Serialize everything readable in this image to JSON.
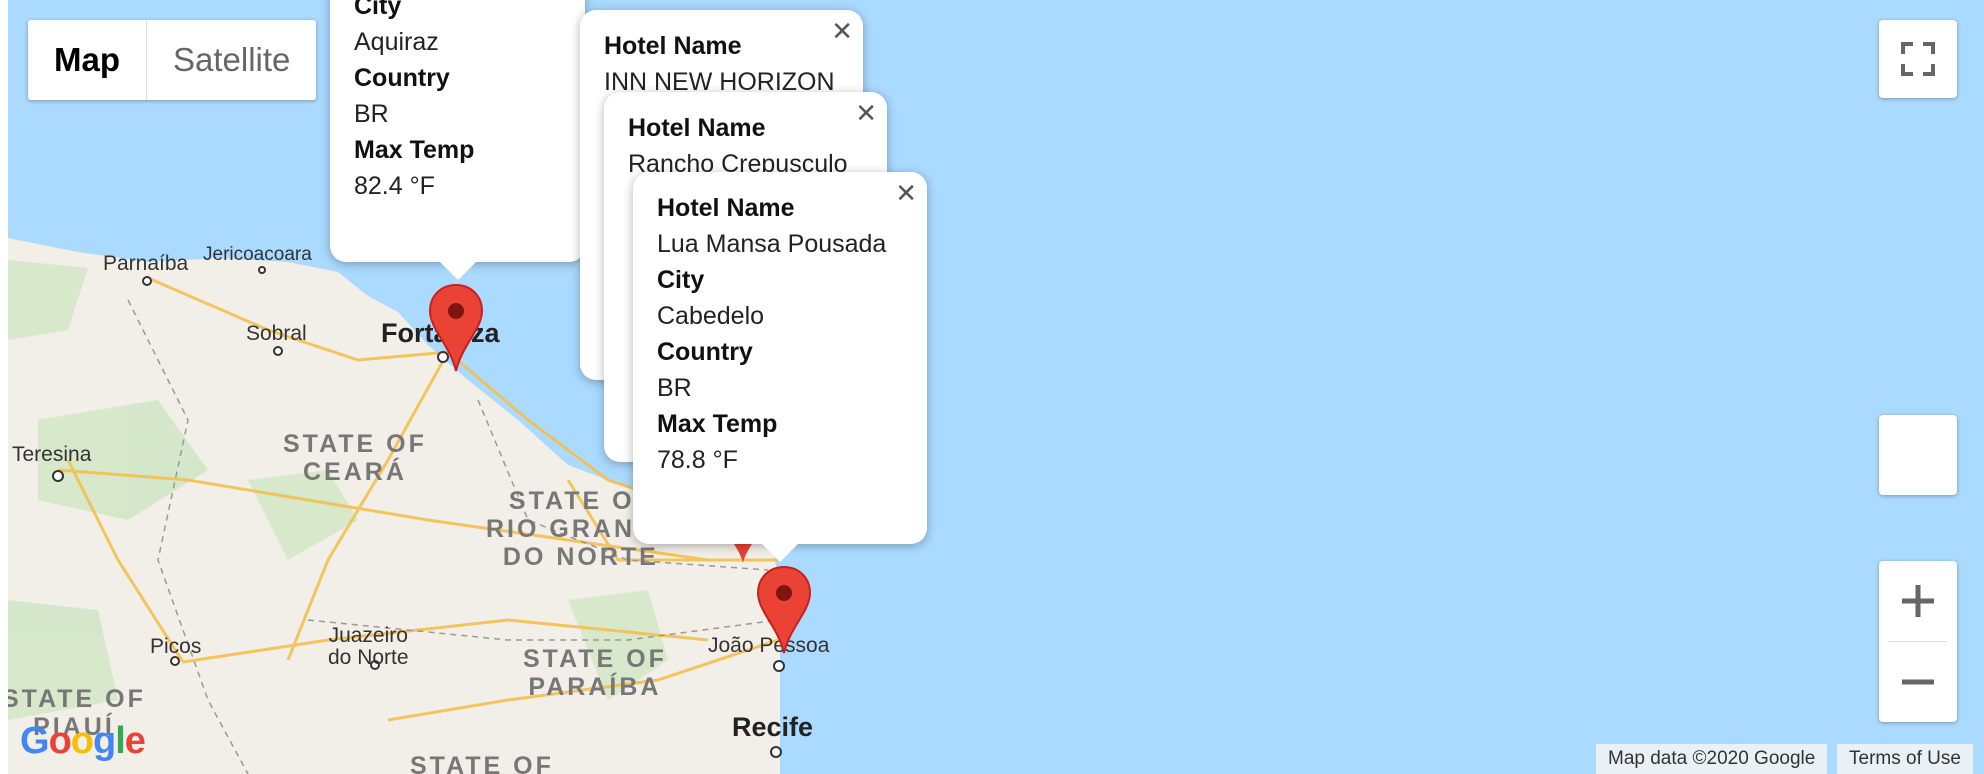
{
  "map_type": {
    "map_label": "Map",
    "satellite_label": "Satellite"
  },
  "places": {
    "parnaiba": "Parnaíba",
    "jericoacoara": "Jericoacoara",
    "sobral": "Sobral",
    "fortaleza": "Fortaleza",
    "teresina": "Teresina",
    "juazeiro": "Juazeiro\ndo Norte",
    "picos": "Picos",
    "joao_pessoa": "João Pessoa",
    "recife": "Recife"
  },
  "states": {
    "ceara": "STATE OF\nCEARÁ",
    "rio_grande": "STATE OF\nRIO GRANDE\nDO NORTE",
    "paraiba": "STATE OF\nPARAÍBA",
    "piaui": "STATE OF\nPIAUÍ",
    "pernambuco": "STATE OF"
  },
  "popups": {
    "aquiraz": {
      "city_label": "City",
      "city": "Aquiraz",
      "country_label": "Country",
      "country": "BR",
      "temp_label": "Max Temp",
      "temp": "82.4 °F"
    },
    "natal": {
      "hotel_label": "Hotel Name",
      "hotel": "INN NEW HORIZON"
    },
    "rancho": {
      "hotel_label": "Hotel Name",
      "hotel": "Rancho Crepusculo"
    },
    "cabedelo": {
      "hotel_label": "Hotel Name",
      "hotel": "Lua Mansa Pousada",
      "city_label": "City",
      "city": "Cabedelo",
      "country_label": "Country",
      "country": "BR",
      "temp_label": "Max Temp",
      "temp": "78.8 °F"
    }
  },
  "icons": {
    "close": "close-icon",
    "fullscreen": "fullscreen-icon",
    "zoom_in": "zoom-in-icon",
    "zoom_out": "zoom-out-icon",
    "marker": "map-marker-icon"
  },
  "attribution": {
    "map_data": "Map data ©2020 Google",
    "terms": "Terms of Use"
  },
  "logo": "Google",
  "colors": {
    "ocean": "#aadaff",
    "land": "#f2efe9",
    "marker": "#ea4335",
    "road": "#f7c85c"
  }
}
